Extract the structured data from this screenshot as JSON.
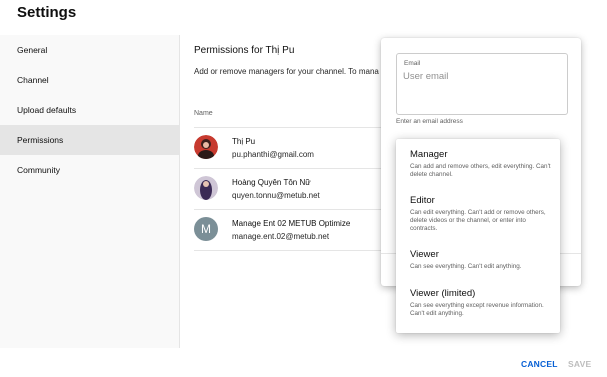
{
  "header": {
    "title": "Settings"
  },
  "sidebar": {
    "items": [
      {
        "label": "General"
      },
      {
        "label": "Channel"
      },
      {
        "label": "Upload defaults"
      },
      {
        "label": "Permissions",
        "active": true
      },
      {
        "label": "Community"
      }
    ]
  },
  "permissions": {
    "title": "Permissions for Thị Pu",
    "description": "Add or remove managers for your channel. To mana",
    "column_name": "Name",
    "members": [
      {
        "name": "Thị Pu",
        "email": "pu.phanthi@gmail.com",
        "avatar": "photo-red"
      },
      {
        "name": "Hoàng Quyên Tôn Nữ",
        "email": "quyen.tonnu@metub.net",
        "avatar": "photo-purple"
      },
      {
        "name": "Manage Ent 02 METUB Optimize",
        "email": "manage.ent.02@metub.net",
        "avatar_letter": "M"
      }
    ]
  },
  "invite": {
    "email_label": "Email",
    "email_placeholder": "User email",
    "email_hint": "Enter an email address"
  },
  "roles": [
    {
      "title": "Manager",
      "description": "Can add and remove others, edit everything. Can't delete channel."
    },
    {
      "title": "Editor",
      "description": "Can edit everything. Can't add or remove others, delete videos or the channel, or enter into contracts."
    },
    {
      "title": "Viewer",
      "description": "Can see everything. Can't edit anything."
    },
    {
      "title": "Viewer (limited)",
      "description": "Can see everything except revenue information. Can't edit anything."
    }
  ],
  "footer": {
    "cancel_label": "CANCEL",
    "save_label": "SAVE"
  },
  "colors": {
    "accent": "#065fd4",
    "active_nav": "#e5e5e5",
    "sidebar_bg": "#f9f9f9",
    "disabled": "#bdbdbd"
  }
}
